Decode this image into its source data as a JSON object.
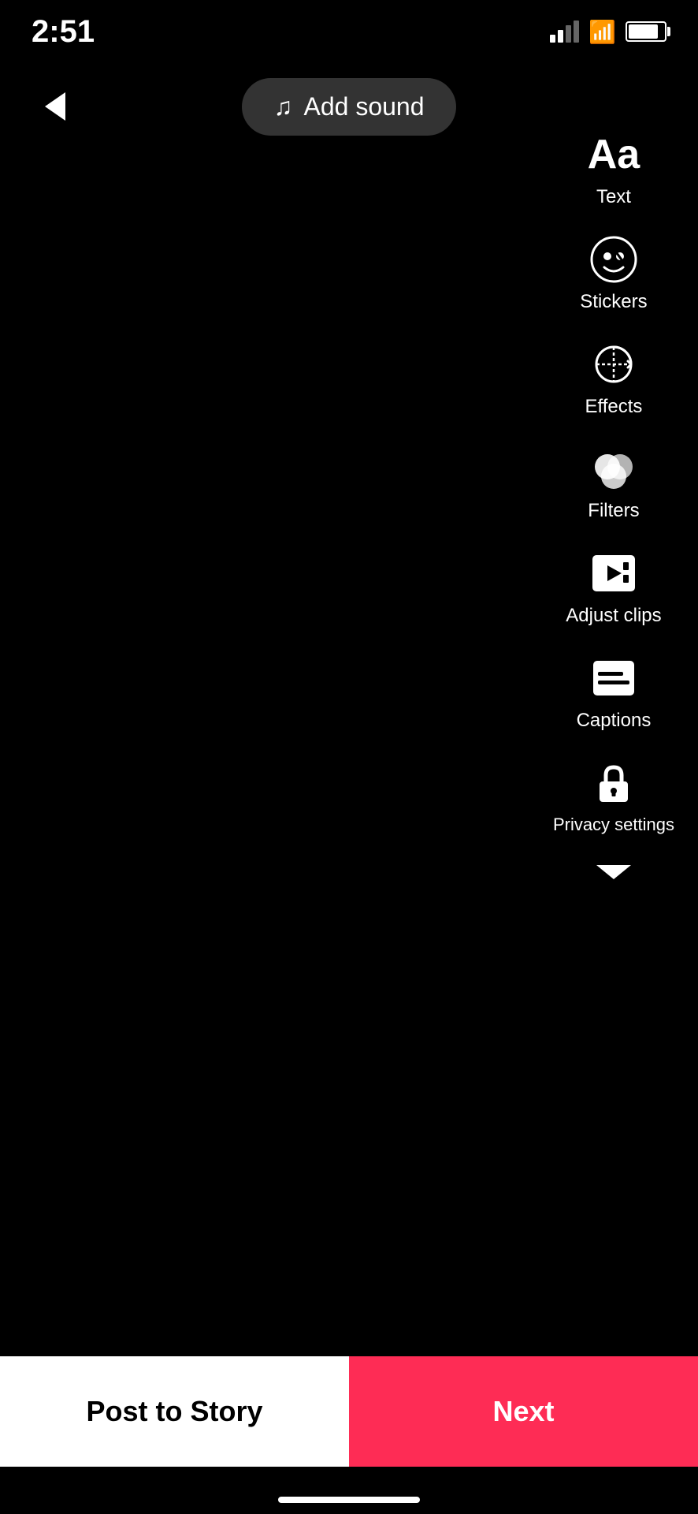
{
  "status": {
    "time": "2:51"
  },
  "top_bar": {
    "add_sound_label": "Add sound"
  },
  "toolbar": {
    "text_label": "Text",
    "stickers_label": "Stickers",
    "effects_label": "Effects",
    "filters_label": "Filters",
    "adjust_clips_label": "Adjust clips",
    "captions_label": "Captions",
    "privacy_label": "Privacy settings"
  },
  "bottom": {
    "post_to_story_label": "Post to Story",
    "next_label": "Next"
  }
}
